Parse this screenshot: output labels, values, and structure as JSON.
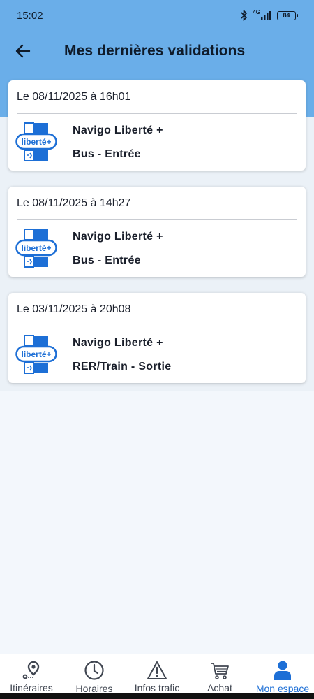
{
  "status_bar": {
    "time": "15:02",
    "network": "4G",
    "battery": "84"
  },
  "header": {
    "title": "Mes dernières validations"
  },
  "validations": [
    {
      "date": "Le 08/11/2025 à 16h01",
      "pass": "Navigo Liberté +",
      "type": "Bus - Entrée"
    },
    {
      "date": "Le 08/11/2025 à 14h27",
      "pass": "Navigo Liberté +",
      "type": "Bus - Entrée"
    },
    {
      "date": "Le 03/11/2025 à 20h08",
      "pass": "Navigo Liberté +",
      "type": "RER/Train - Sortie"
    }
  ],
  "logo_text": "liberté+",
  "bottom_nav": [
    {
      "label": "Itinéraires",
      "icon": "map-pin-icon"
    },
    {
      "label": "Horaires",
      "icon": "clock-icon"
    },
    {
      "label": "Infos trafic",
      "icon": "warning-icon"
    },
    {
      "label": "Achat",
      "icon": "cart-icon"
    },
    {
      "label": "Mon espace",
      "icon": "user-icon",
      "active": true
    }
  ],
  "colors": {
    "header": "#6aaee9",
    "accent": "#1d6fd6",
    "text": "#1a1f2b"
  }
}
